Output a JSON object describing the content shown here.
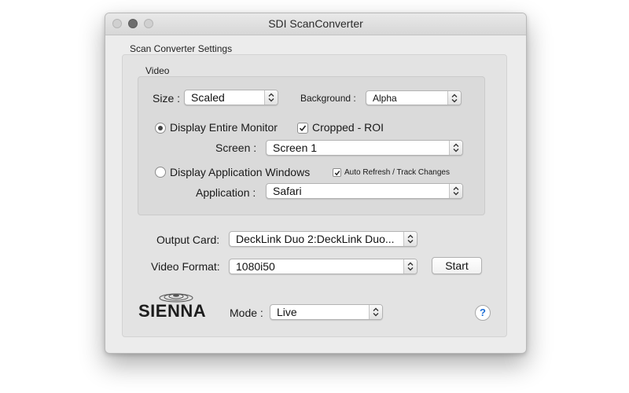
{
  "window": {
    "title": "SDI ScanConverter"
  },
  "settings_group": {
    "label": "Scan Converter Settings"
  },
  "video_group": {
    "label": "Video",
    "size": {
      "label": "Size :",
      "value": "Scaled"
    },
    "background": {
      "label": "Background :",
      "value": "Alpha"
    },
    "display_entire_monitor": {
      "label": "Display Entire Monitor",
      "selected": true
    },
    "cropped_roi": {
      "label": "Cropped - ROI",
      "checked": true
    },
    "screen": {
      "label": "Screen :",
      "value": "Screen 1"
    },
    "display_application_windows": {
      "label": "Display Application Windows",
      "selected": false
    },
    "auto_refresh": {
      "label": "Auto Refresh / Track Changes",
      "checked": true
    },
    "application": {
      "label": "Application :",
      "value": "Safari"
    }
  },
  "output_card": {
    "label": "Output Card:",
    "value": "DeckLink Duo 2:DeckLink Duo..."
  },
  "video_format": {
    "label": "Video Format:",
    "value": "1080i50"
  },
  "start_button": {
    "label": "Start"
  },
  "logo": {
    "text": "SIENNA"
  },
  "mode": {
    "label": "Mode :",
    "value": "Live"
  },
  "help_button": {
    "label": "?"
  },
  "colors": {
    "window_bg": "#ececec",
    "help_accent": "#1f6fd6"
  }
}
